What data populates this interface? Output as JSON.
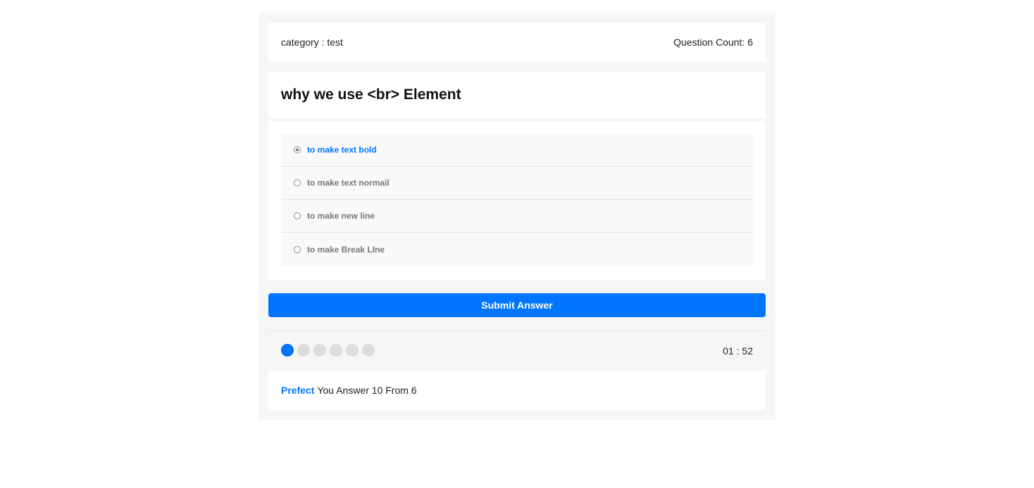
{
  "quiz_info": {
    "category": "category : test",
    "question_count": "Question Count: 6"
  },
  "question": {
    "title": "why we use <br> Element"
  },
  "answers": [
    {
      "label": "to make text bold",
      "selected": true
    },
    {
      "label": "to make text normail",
      "selected": false
    },
    {
      "label": "to make new line",
      "selected": false
    },
    {
      "label": "to make Break LIne",
      "selected": false
    }
  ],
  "submit_label": "Submit Answer",
  "progress": {
    "total": 6,
    "current": 1
  },
  "countdown": "01 : 52",
  "results": {
    "grade": "Prefect",
    "text": "You Answer 10 From 6"
  },
  "colors": {
    "accent": "#0075ff",
    "inactive_bullet": "#dddddd"
  }
}
